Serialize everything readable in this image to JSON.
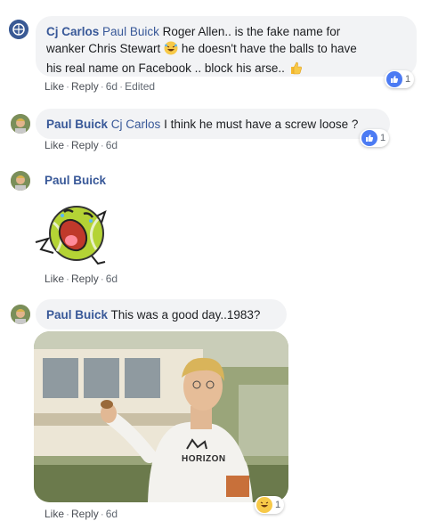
{
  "comments": [
    {
      "author": "Cj Carlos",
      "mention": "Paul Buick",
      "text_line1": "Roger Allen.. is the fake name for",
      "text_line2": "wanker Chris Stewart",
      "text_line2b": "he doesn't have the balls to have",
      "text_line3": "his real name on Facebook .. block his arse..",
      "actions": {
        "like": "Like",
        "reply": "Reply",
        "time": "6d",
        "edited": "Edited"
      },
      "reaction_count": "1",
      "reaction_type": "like-icon"
    },
    {
      "author": "Paul Buick",
      "mention": "Cj Carlos",
      "text": "I think he must have a screw loose ?",
      "actions": {
        "like": "Like",
        "reply": "Reply",
        "time": "6d"
      },
      "reaction_count": "1",
      "reaction_type": "like-icon"
    },
    {
      "author": "Paul Buick",
      "sticker": "laughing-tennis-ball-sticker",
      "actions": {
        "like": "Like",
        "reply": "Reply",
        "time": "6d"
      }
    },
    {
      "author": "Paul Buick",
      "text": "This was a good day..1983?",
      "photo_shirt_text": "HORIZON",
      "actions": {
        "like": "Like",
        "reply": "Reply",
        "time": "6d"
      },
      "reaction_count": "1",
      "reaction_type": "haha-icon"
    }
  ],
  "colors": {
    "link": "#385898",
    "bubble": "#f2f3f5",
    "meta": "#606770",
    "like": "#4c7bf3"
  }
}
